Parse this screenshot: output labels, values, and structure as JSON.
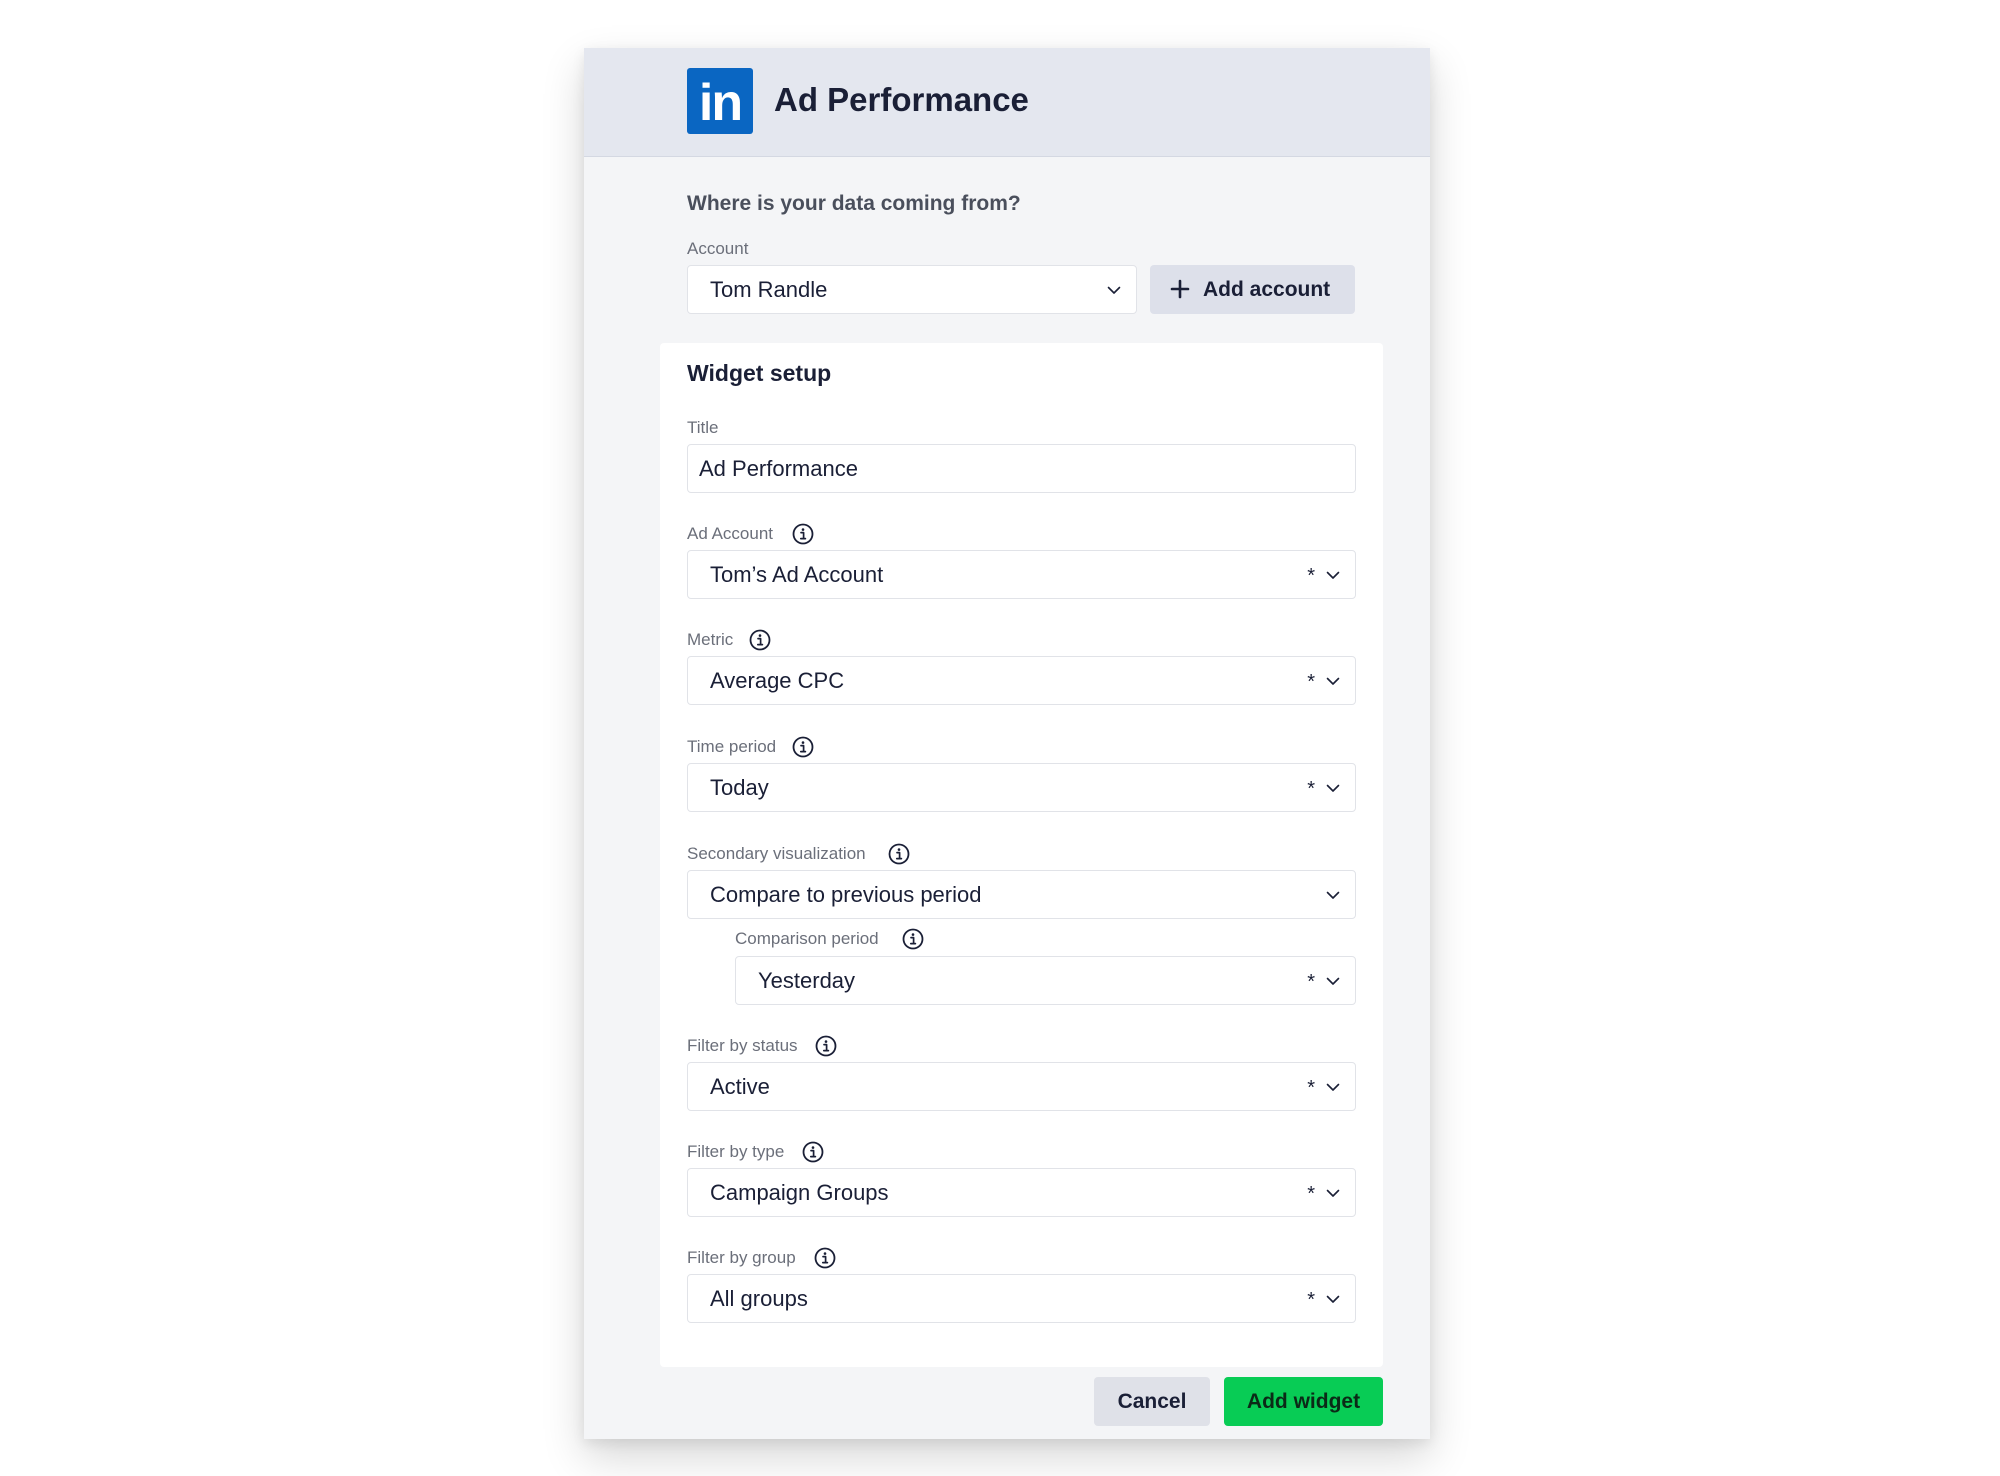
{
  "header": {
    "logo_text": "in",
    "title": "Ad Performance"
  },
  "source": {
    "question": "Where is your data coming from?",
    "account_label": "Account",
    "account_value": "Tom Randle",
    "add_account_label": "Add account"
  },
  "widget_setup": {
    "heading": "Widget setup",
    "title_label": "Title",
    "title_value": "Ad Performance",
    "ad_account": {
      "label": "Ad Account",
      "value": "Tom’s Ad Account",
      "required": "*"
    },
    "metric": {
      "label": "Metric",
      "value": "Average CPC",
      "required": "*"
    },
    "time_period": {
      "label": "Time period",
      "value": "Today",
      "required": "*"
    },
    "secondary_visualization": {
      "label": "Secondary visualization",
      "value": "Compare to previous period"
    },
    "comparison_period": {
      "label": "Comparison period",
      "value": "Yesterday",
      "required": "*"
    },
    "filter_status": {
      "label": "Filter by status",
      "value": "Active",
      "required": "*"
    },
    "filter_type": {
      "label": "Filter by type",
      "value": "Campaign Groups",
      "required": "*"
    },
    "filter_group": {
      "label": "Filter by group",
      "value": "All groups",
      "required": "*"
    }
  },
  "footer": {
    "cancel_label": "Cancel",
    "add_widget_label": "Add widget"
  },
  "icons": {
    "info": "info-icon",
    "chevron": "chevron-down-icon",
    "plus": "plus-icon"
  },
  "colors": {
    "linkedin_blue": "#0a66c2",
    "primary_green": "#08cc55",
    "header_bg": "#e4e7ef"
  }
}
